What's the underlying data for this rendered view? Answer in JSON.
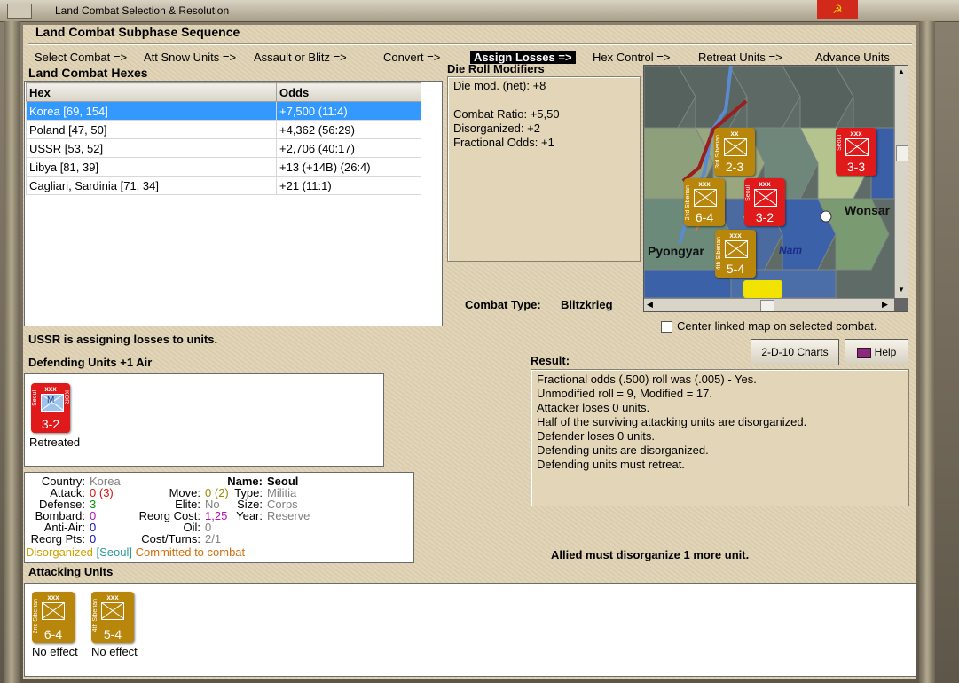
{
  "window": {
    "title": "Land Combat Selection & Resolution",
    "close_glyph": "☭"
  },
  "subphase": {
    "heading": "Land Combat Subphase Sequence",
    "steps": [
      "Select Combat =>",
      "Att Snow Units =>",
      "Assault or Blitz =>",
      "Convert =>",
      "Assign Losses =>",
      "Hex Control =>",
      "Retreat Units =>",
      "Advance Units"
    ]
  },
  "hexes": {
    "heading": "Land Combat Hexes",
    "columns": [
      "Hex",
      "Odds"
    ],
    "rows": [
      [
        "Korea [69, 154]",
        "+7,500 (11:4)"
      ],
      [
        "Poland [47, 50]",
        "+4,362 (56:29)"
      ],
      [
        "USSR [53, 52]",
        "+2,706 (40:17)"
      ],
      [
        "Libya [81, 39]",
        "+13 (+14B) (26:4)"
      ],
      [
        "Cagliari, Sardinia [71, 34]",
        "+21 (11:1)"
      ]
    ]
  },
  "modifiers": {
    "heading": "Die Roll Modifiers",
    "lines": [
      "Die mod. (net): +8",
      "",
      "Combat Ratio: +5,50",
      "Disorganized: +2",
      "Fractional Odds: +1"
    ]
  },
  "combat_type": {
    "label": "Combat Type:",
    "value": "Blitzkrieg"
  },
  "map": {
    "labels": [
      "Pyongyar",
      "Wonsar",
      "Nam"
    ],
    "counters": [
      {
        "top": "xx",
        "str": "2-3",
        "side": "3rd Siberian"
      },
      {
        "top": "xxx",
        "str": "3-3",
        "side": "Seoul"
      },
      {
        "top": "xxx",
        "str": "6-4",
        "side": "2nd Siberian"
      },
      {
        "top": "xxx",
        "str": "3-2",
        "side": "Seoul"
      },
      {
        "top": "xxx",
        "str": "5-4",
        "side": "4th Siberian"
      }
    ]
  },
  "center_checkbox": {
    "label": "Center linked map on selected combat.",
    "checked": false
  },
  "status": "USSR is assigning losses to units.",
  "buttons": {
    "charts": "2-D-10 Charts",
    "help": "Help"
  },
  "defending": {
    "heading": "Defending Units +1 Air",
    "units": [
      {
        "top": "xxx",
        "sym": "M",
        "str": "3-2",
        "side": "Seoul",
        "side2": "KOR",
        "status": "Retreated"
      }
    ]
  },
  "details": {
    "country_label": "Country:",
    "country": "Korea",
    "attack_label": "Attack:",
    "attack": "0",
    "attack_base": "(3)",
    "defense_label": "Defense:",
    "defense": "3",
    "bombard_label": "Bombard:",
    "bombard": "0",
    "antiair_label": "Anti-Air:",
    "antiair": "0",
    "reorgpts_label": "Reorg Pts:",
    "reorgpts": "0",
    "move_label": "Move:",
    "move": "0",
    "move_base": "(2)",
    "elite_label": "Elite:",
    "elite": "No",
    "reorgcost_label": "Reorg Cost:",
    "reorgcost": "1,25",
    "oil_label": "Oil:",
    "oil": "0",
    "costturns_label": "Cost/Turns:",
    "costturns": "2/1",
    "name_label": "Name:",
    "name": "Seoul",
    "type_label": "Type:",
    "type": "Militia",
    "size_label": "Size:",
    "size": "Corps",
    "year_label": "Year:",
    "year": "Reserve",
    "flag1": "Disorganized",
    "flag2": "[Seoul]",
    "flag3": "Committed to combat"
  },
  "result": {
    "heading": "Result:",
    "lines": [
      "Fractional odds (.500) roll was (.005)  - Yes.",
      "Unmodified roll = 9, Modified = 17.",
      "Attacker loses 0 units.",
      "Half of the surviving attacking units are disorganized.",
      "Defender loses 0 units.",
      "Defending units are disorganized.",
      "Defending units must retreat."
    ]
  },
  "allied_message": "Allied must disorganize 1 more unit.",
  "attacking": {
    "heading": "Attacking Units",
    "units": [
      {
        "top": "xxx",
        "str": "6-4",
        "side": "2nd Siberian",
        "status": "No effect"
      },
      {
        "top": "xxx",
        "str": "5-4",
        "side": "4th Siberian",
        "status": "No effect"
      }
    ]
  },
  "colors": {
    "selected_row": "#3399ff",
    "soviet_counter": "#b8860b",
    "korean_counter": "#e01a1a",
    "parchment": "#e1d3b4"
  }
}
